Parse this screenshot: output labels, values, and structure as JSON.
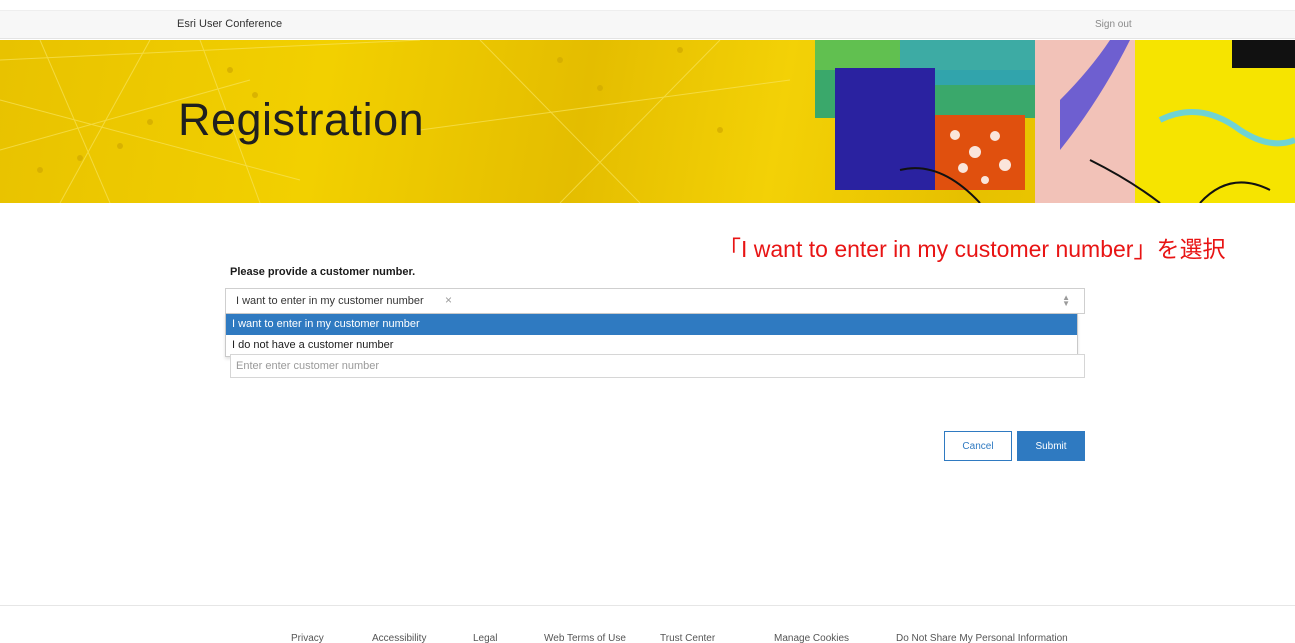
{
  "header": {
    "brand": "Esri User Conference",
    "sign_out": "Sign out"
  },
  "banner": {
    "title": "Registration"
  },
  "annotation": "「I want to enter in my customer number」を選択",
  "form": {
    "label": "Please provide a customer number.",
    "select_value": "I want to enter in my customer number",
    "clear_symbol": "×",
    "options": [
      "I want to enter in my customer number",
      "I do not have a customer number"
    ],
    "customer_number_placeholder": "Enter enter customer number",
    "cancel_label": "Cancel",
    "submit_label": "Submit"
  },
  "footer": {
    "links": [
      "Privacy",
      "Accessibility",
      "Legal",
      "Web Terms of Use",
      "Trust Center",
      "Manage Cookies",
      "Do Not Share My Personal Information"
    ]
  },
  "colors": {
    "accent": "#2f7ac1",
    "banner_yellow": "#f2d000",
    "annotation_red": "#e81414"
  }
}
